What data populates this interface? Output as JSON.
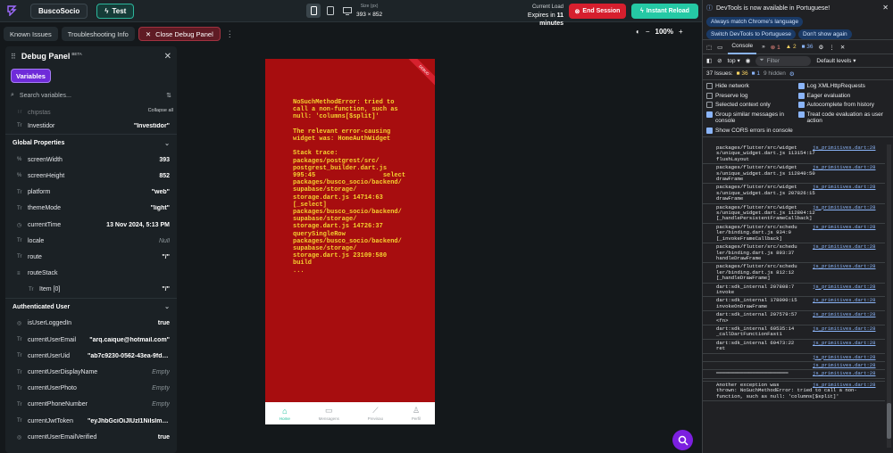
{
  "topbar": {
    "project": "BuscoSocio",
    "test_label": "Test",
    "size_label": "Size (px)",
    "size_value": "393 × 852",
    "load_label": "Current Load",
    "load_value_prefix": "Expires in",
    "load_value_strong": "11 minutes",
    "end_label": "End Session",
    "reload_label": "Instant Reload"
  },
  "toolbar": {
    "known_issues": "Known Issues",
    "troubleshooting": "Troubleshooting Info",
    "close_debug": "Close Debug Panel",
    "zoom": "100%"
  },
  "panel": {
    "title": "Debug Panel",
    "beta": "BETA",
    "variables_tab": "Variables",
    "search_placeholder": "Search variables...",
    "collapse_all": "Collapse all",
    "top_rows": [
      {
        "type": "Tr",
        "key": "chipstas",
        "value": ""
      },
      {
        "type": "Tr",
        "key": "Investidor",
        "value": "\"Investidor\""
      }
    ],
    "global_title": "Global Properties",
    "global": [
      {
        "type": "%",
        "key": "screenWidth",
        "value": "393",
        "muted": false
      },
      {
        "type": "%",
        "key": "screenHeight",
        "value": "852",
        "muted": false
      },
      {
        "type": "Tr",
        "key": "platform",
        "value": "\"web\"",
        "muted": false
      },
      {
        "type": "Tr",
        "key": "themeMode",
        "value": "\"light\"",
        "muted": false
      },
      {
        "type": "◷",
        "key": "currentTime",
        "value": "13 Nov 2024, 5:13 PM",
        "muted": false
      },
      {
        "type": "Tr",
        "key": "locale",
        "value": "Null",
        "muted": true
      },
      {
        "type": "Tr",
        "key": "route",
        "value": "\"/\"",
        "muted": false
      },
      {
        "type": "≡",
        "key": "routeStack",
        "value": "",
        "muted": false
      },
      {
        "type": "Tr",
        "key": "Item [0]",
        "value": "\"/\"",
        "muted": false,
        "sub": true
      }
    ],
    "auth_title": "Authenticated User",
    "auth": [
      {
        "type": "◎",
        "key": "isUserLoggedIn",
        "value": "true",
        "muted": false
      },
      {
        "type": "Tr",
        "key": "currentUserEmail",
        "value": "\"arq.caique@hotmail.com\"",
        "muted": false
      },
      {
        "type": "Tr",
        "key": "currentUserUid",
        "value": "\"ab7c9230-0562-43ea-9fd7-356b...",
        "muted": false
      },
      {
        "type": "Tr",
        "key": "currentUserDisplayName",
        "value": "Empty",
        "muted": true
      },
      {
        "type": "Tr",
        "key": "currentUserPhoto",
        "value": "Empty",
        "muted": true
      },
      {
        "type": "Tr",
        "key": "currentPhoneNumber",
        "value": "Empty",
        "muted": true
      },
      {
        "type": "Tr",
        "key": "currentJwtToken",
        "value": "\"eyJhbGciOiJIUzI1NiIsImtpZCI6...",
        "muted": false
      },
      {
        "type": "◎",
        "key": "currentUserEmailVerified",
        "value": "true",
        "muted": false
      }
    ]
  },
  "phone": {
    "debug_ribbon": "DEBUG",
    "error_text": "NoSuchMethodError: tried to\ncall a non-function, such as\nnull: 'columns[$split]'\n\nThe relevant error-causing\nwidget was: HomeAuthWidget\n\nStack trace:\npackages/postgrest/src/\npostgrest_builder.dart.js\n995:45                  select\npackages/busco_socio/backend/\nsupabase/storage/\nstorage.dart.js 14714:63\n[_select]\npackages/busco_socio/backend/\nsupabase/storage/\nstorage.dart.js 14726:37\nquerySingleRow\npackages/busco_socio/backend/\nsupabase/storage/\nstorage.dart.js 23109:580\nbuild\n...",
    "nav": [
      {
        "label": "Home",
        "active": true
      },
      {
        "label": "Mensagens",
        "active": false
      },
      {
        "label": "Previsao",
        "active": false
      },
      {
        "label": "Perfil",
        "active": false
      }
    ]
  },
  "devtools": {
    "notice": "DevTools is now available in Portuguese!",
    "btn_match": "Always match Chrome's language",
    "btn_switch": "Switch DevTools to Portuguese",
    "btn_dont": "Don't show again",
    "tab_console": "Console",
    "err_count": "1",
    "warn_count": "2",
    "info_count": "36",
    "context": "top",
    "filter_placeholder": "Filter",
    "levels": "Default levels",
    "issues_label": "37 Issues:",
    "issues_warn": "36",
    "issues_info": "1",
    "hidden": "9 hidden",
    "options": [
      {
        "label": "Hide network",
        "checked": false
      },
      {
        "label": "Log XMLHttpRequests",
        "checked": true
      },
      {
        "label": "Preserve log",
        "checked": false
      },
      {
        "label": "Eager evaluation",
        "checked": true
      },
      {
        "label": "Selected context only",
        "checked": false
      },
      {
        "label": "Autocomplete from history",
        "checked": true
      },
      {
        "label": "Group similar messages in console",
        "checked": true
      },
      {
        "label": "Treat code evaluation as user action",
        "checked": true
      },
      {
        "label": "Show CORS errors in console",
        "checked": true
      }
    ],
    "log": [
      {
        "text": "packages/flutter/src/widget\ns/unique_widget.dart.js 113154:17\nflushLayout",
        "src": "js_primitives.dart:28"
      },
      {
        "text": "packages/flutter/src/widget\ns/unique_widget.dart.js 112840:50\ndrawFrame",
        "src": "js_primitives.dart:28"
      },
      {
        "text": "packages/flutter/src/widget\ns/unique_widget.dart.js 207826:15\ndrawFrame",
        "src": "js_primitives.dart:28"
      },
      {
        "text": "packages/flutter/src/widget\ns/unique_widget.dart.js 112804:12\n[_handlePersistentFrameCallback]",
        "src": "js_primitives.dart:28"
      },
      {
        "text": "packages/flutter/src/schedu\nler/binding.dart.js 934:9\n[_invokeFrameCallback]",
        "src": "js_primitives.dart:28"
      },
      {
        "text": "packages/flutter/src/schedu\nler/binding.dart.js 893:37\nhandleDrawFrame",
        "src": "js_primitives.dart:28"
      },
      {
        "text": "packages/flutter/src/schedu\nler/binding.dart.js 812:12\n[_handleDrawFrame]",
        "src": "js_primitives.dart:28"
      },
      {
        "text": "dart:sdk_internal 207808:7\ninvoke",
        "src": "js_primitives.dart:28"
      },
      {
        "text": "dart:sdk_internal 178090:15\ninvokeOnDrawFrame",
        "src": "js_primitives.dart:28"
      },
      {
        "text": "dart:sdk_internal 207579:57\n<fn>",
        "src": "js_primitives.dart:28"
      },
      {
        "text": "dart:sdk_internal 69535:14\n_callDartFunctionFast1",
        "src": "js_primitives.dart:28"
      },
      {
        "text": "dart:sdk_internal 69473:22\nret",
        "src": "js_primitives.dart:28"
      },
      {
        "text": "",
        "src": "js_primitives.dart:28"
      },
      {
        "text": "",
        "src": "js_primitives.dart:28"
      },
      {
        "text": "════════════════════════",
        "src": "js_primitives.dart:28"
      },
      {
        "text": "",
        "src": ""
      },
      {
        "text": "Another exception was\nthrown: NoSuchMethodError: tried to call a non-\nfunction, such as null: 'columns[$split]'",
        "src": "js_primitives.dart:28"
      }
    ]
  }
}
